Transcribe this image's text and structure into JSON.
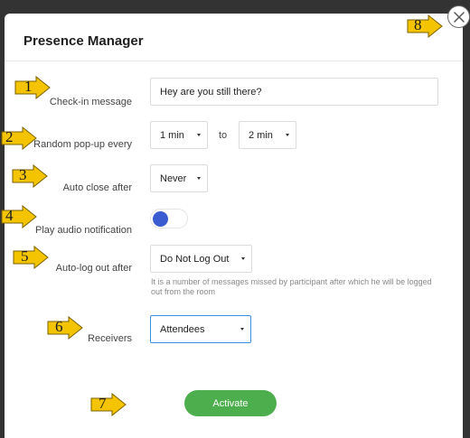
{
  "dialog": {
    "title": "Presence Manager",
    "close_icon": "close-icon"
  },
  "form": {
    "checkin": {
      "label": "Check-in message",
      "value": "Hey are you still there?"
    },
    "random_popup": {
      "label": "Random pop-up every",
      "from_value": "1 min",
      "to_label": "to",
      "to_value": "2 min"
    },
    "auto_close": {
      "label": "Auto close after",
      "value": "Never"
    },
    "audio": {
      "label": "Play audio notification",
      "enabled": false
    },
    "auto_logout": {
      "label": "Auto-log out after",
      "value": "Do Not Log Out",
      "help": "It is a number of messages missed by participant after which he will be logged out from the room"
    },
    "receivers": {
      "label": "Receivers",
      "value": "Attendees"
    },
    "activate_label": "Activate"
  },
  "markers": [
    "1",
    "2",
    "3",
    "4",
    "5",
    "6",
    "7",
    "8"
  ],
  "colors": {
    "marker_fill": "#f5c400",
    "activate": "#4cae4c",
    "toggle_knob": "#3b5bd1",
    "focus": "#3d8fe0"
  }
}
